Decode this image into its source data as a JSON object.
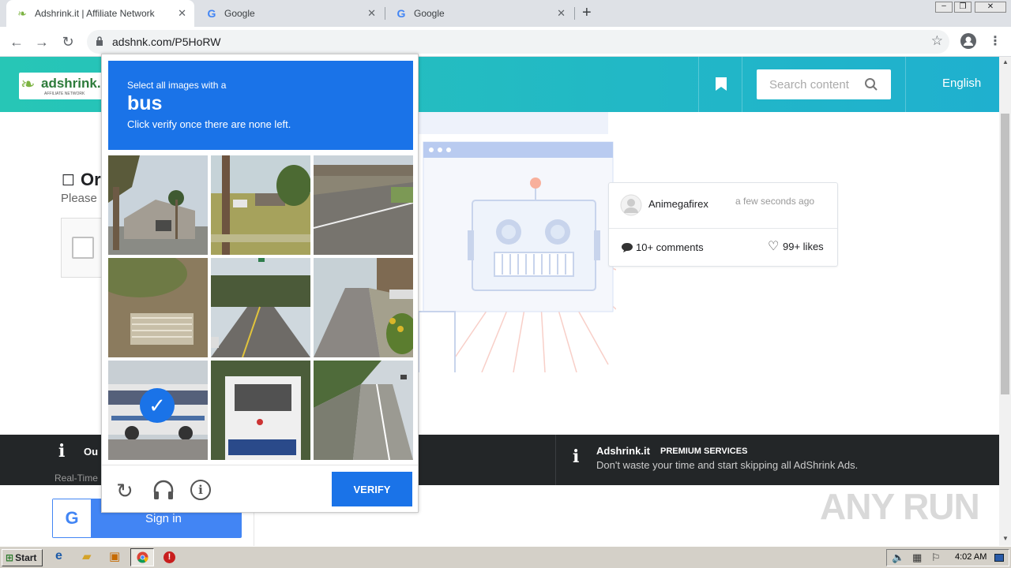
{
  "browser": {
    "tabs": [
      {
        "title": "Adshrink.it | Affiliate Network"
      },
      {
        "title": "Google"
      },
      {
        "title": "Google"
      }
    ],
    "url": "adshnk.com/P5HoRW"
  },
  "site": {
    "logo_text": "adshrink.it",
    "logo_sub": "AFFILIATE NETWORK",
    "search_placeholder": "Search content",
    "language": "English"
  },
  "page": {
    "heading_partial": "Or",
    "subtext_partial": "Please",
    "card": {
      "username": "Animegafirex",
      "time": "a few seconds ago",
      "comments": "10+ comments",
      "likes": "99+ likes"
    },
    "footer": {
      "left_title_partial": "Ou",
      "left_sub_partial": "Real-Time",
      "brand": "Adshrink.it",
      "premium": "PREMIUM SERVICES",
      "tagline": "Don't waste your time and start skipping all AdShrink Ads."
    },
    "signin_label": "Sign in"
  },
  "captcha": {
    "instruction": "Select all images with a",
    "target": "bus",
    "subinstruction": "Click verify once there are none left.",
    "verify_label": "VERIFY",
    "tiles": [
      {
        "desc": "palm-house",
        "selected": false
      },
      {
        "desc": "pole-yard",
        "selected": false
      },
      {
        "desc": "road-lot",
        "selected": false
      },
      {
        "desc": "dirt-steps",
        "selected": false
      },
      {
        "desc": "road-trees",
        "selected": false
      },
      {
        "desc": "street-curb",
        "selected": false
      },
      {
        "desc": "bus-side",
        "selected": true
      },
      {
        "desc": "bus-rear",
        "selected": false
      },
      {
        "desc": "bridge-road",
        "selected": false
      }
    ]
  },
  "watermark": "ANY RUN",
  "taskbar": {
    "start_label": "Start",
    "clock": "4:02 AM"
  },
  "colors": {
    "captcha_blue": "#1a73e8",
    "header_teal": "#27c6b6",
    "footer_dark": "#232628"
  }
}
